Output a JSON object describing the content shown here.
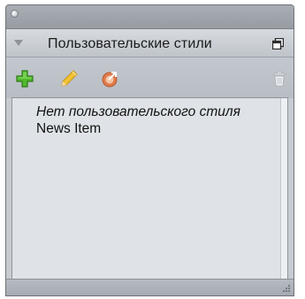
{
  "panel": {
    "title": "Пользовательские стили"
  },
  "toolbar": {
    "buttons": [
      {
        "name": "new-style",
        "icon": "plus-icon"
      },
      {
        "name": "edit-style",
        "icon": "pencil-icon"
      },
      {
        "name": "apply-style",
        "icon": "link-icon"
      },
      {
        "name": "delete-style",
        "icon": "trash-icon"
      }
    ]
  },
  "styles": {
    "items": [
      {
        "label": "Нет пользовательского стиля",
        "italic": true
      },
      {
        "label": "News Item",
        "italic": false
      }
    ]
  },
  "colors": {
    "accent_green": "#4fb92d",
    "pencil_yellow": "#f1c232",
    "link_orange": "#e07a4b"
  }
}
